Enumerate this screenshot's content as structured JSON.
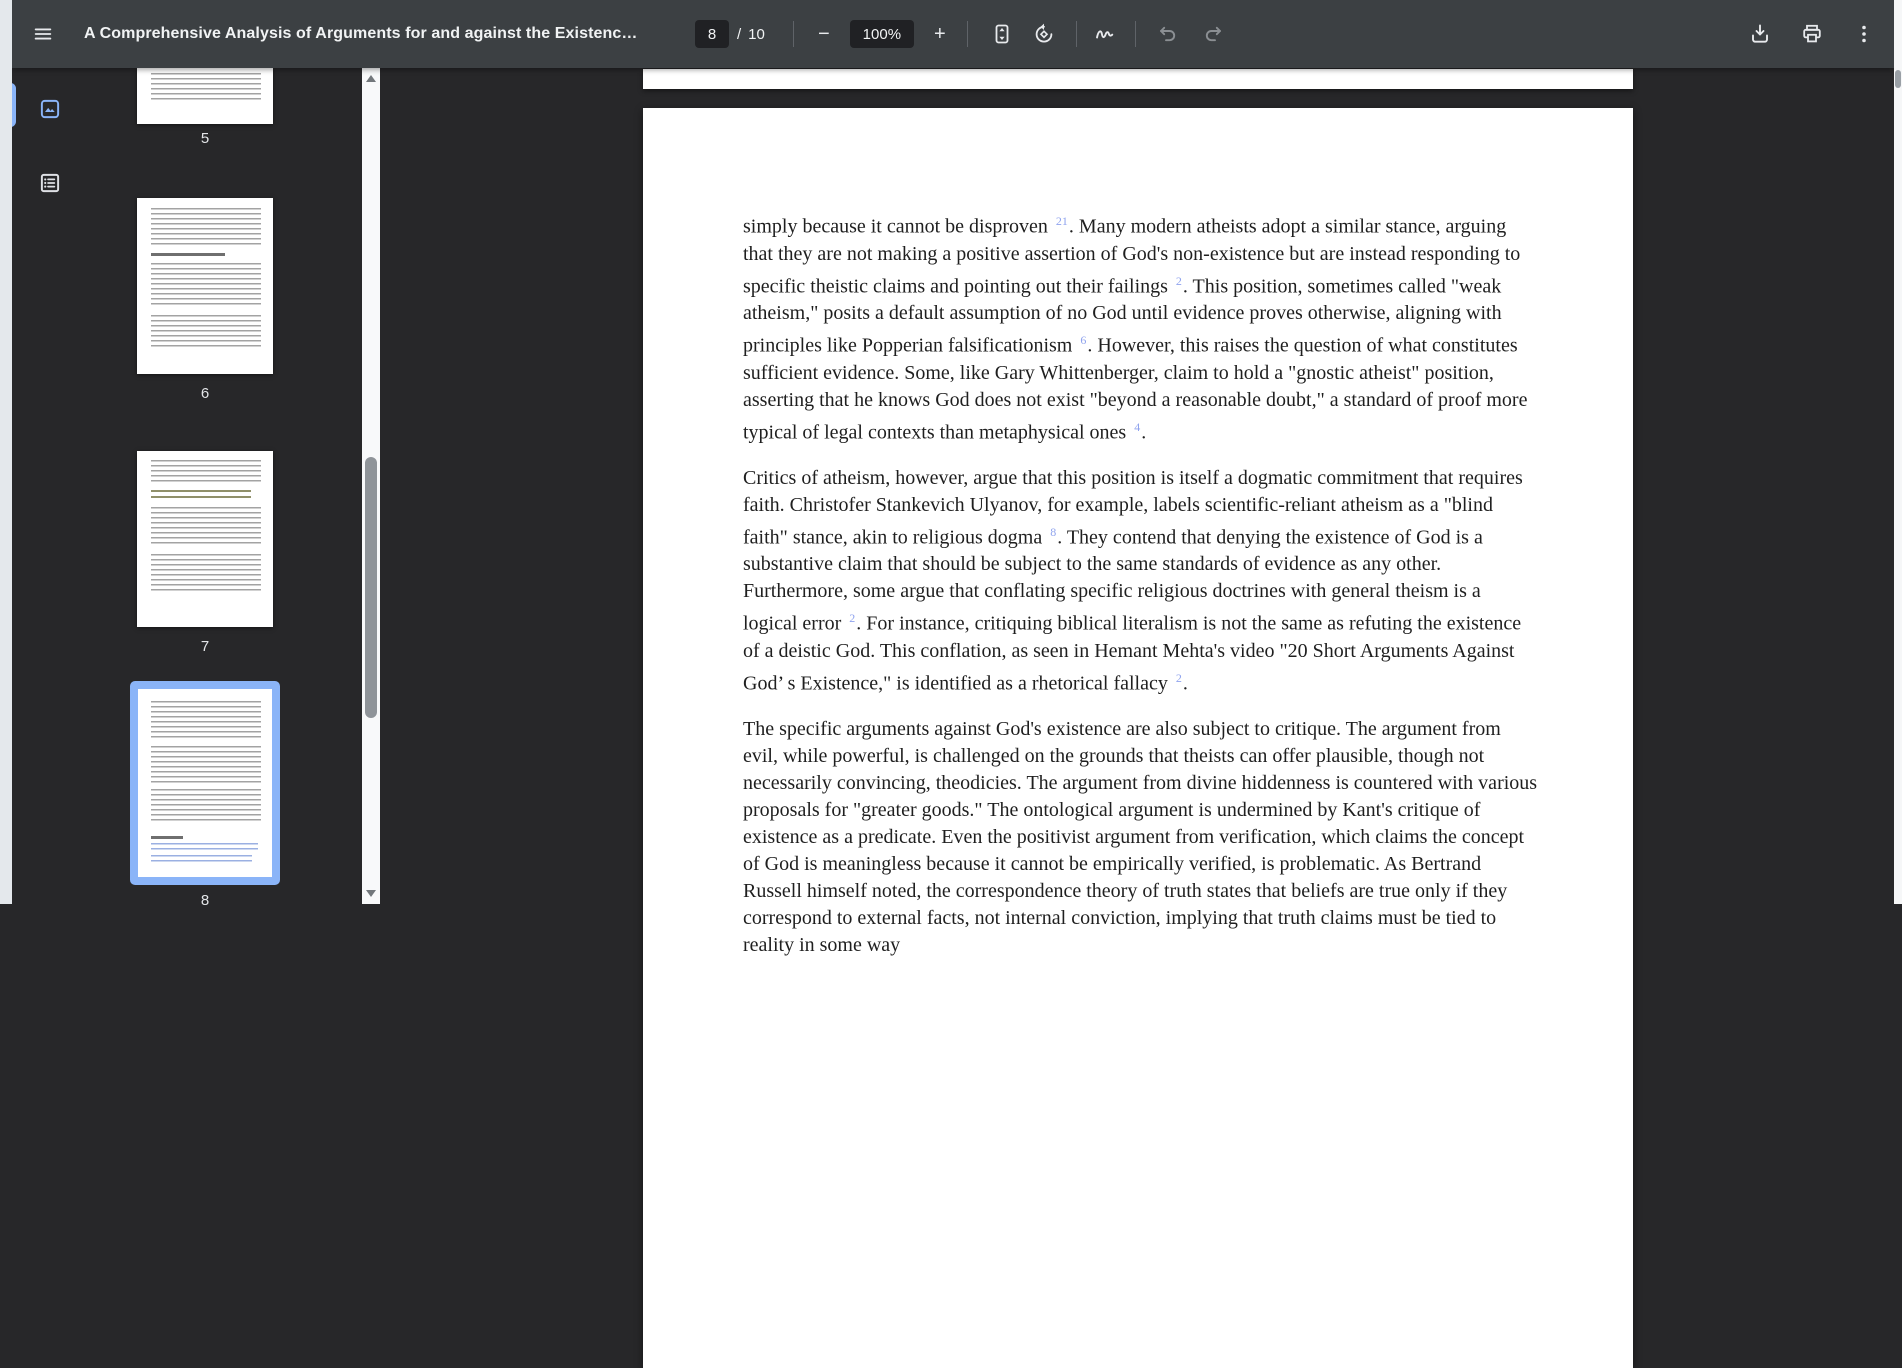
{
  "toolbar": {
    "title": "A Comprehensive Analysis of Arguments for and against the Existenc…",
    "page_input": "8",
    "page_divider": "/",
    "page_count": "10",
    "zoom_out_glyph": "−",
    "zoom_level": "100%",
    "zoom_in_glyph": "+",
    "icons": {
      "menu": "hamburger-menu",
      "fit": "fit-to-page",
      "rotate": "rotate-counterclockwise",
      "annotate": "pen-annotate",
      "undo": "undo-arrow",
      "redo": "redo-arrow",
      "download": "download-tray",
      "print": "printer",
      "more": "more-vertical-dots"
    }
  },
  "sidebar": {
    "views": [
      {
        "name": "thumbnails",
        "selected": true
      },
      {
        "name": "document-outline",
        "selected": false
      }
    ]
  },
  "thumbnails": {
    "pages": [
      {
        "label": "5",
        "selected": false
      },
      {
        "label": "6",
        "selected": false
      },
      {
        "label": "7",
        "selected": false
      },
      {
        "label": "8",
        "selected": true
      }
    ]
  },
  "document": {
    "paragraphs": [
      {
        "segments": [
          {
            "text": "simply because it cannot be disproven "
          },
          {
            "sup": "21"
          },
          {
            "text": ". Many modern atheists adopt a similar stance, arguing that they are not making a positive assertion of God's non-existence but are instead responding to specific theistic claims and pointing out their failings "
          },
          {
            "sup": "2"
          },
          {
            "text": ". This position, sometimes called \"weak atheism,\" posits a default assumption of no God until evidence proves otherwise, aligning with principles like Popperian falsificationism "
          },
          {
            "sup": "6"
          },
          {
            "text": ". However, this raises the question of what constitutes sufficient evidence. Some, like Gary Whittenberger, claim to hold a \"gnostic atheist\" position, asserting that he knows God does not exist \"beyond a reasonable doubt,\" a standard of proof more typical of legal contexts than metaphysical ones "
          },
          {
            "sup": "4"
          },
          {
            "text": "."
          }
        ]
      },
      {
        "segments": [
          {
            "text": "Critics of atheism, however, argue that this position is itself a dogmatic commitment that requires faith. Christofer Stankevich Ulyanov, for example, labels scientific-reliant atheism as a \"blind faith\" stance, akin to religious dogma "
          },
          {
            "sup": "8"
          },
          {
            "text": ". They contend that denying the existence of God is a substantive claim that should be subject to the same standards of evidence as any other. Furthermore, some argue that conflating specific religious doctrines with general theism is a logical error "
          },
          {
            "sup": "2"
          },
          {
            "text": ". For instance, critiquing biblical literalism is not the same as refuting the existence of a deistic God. This conflation, as seen in Hemant Mehta's video \"20 Short Arguments Against God’ s Existence,\" is identified as a rhetorical fallacy "
          },
          {
            "sup": "2"
          },
          {
            "text": "."
          }
        ]
      },
      {
        "segments": [
          {
            "text": "The specific arguments against God's existence are also subject to critique. The argument from evil, while powerful, is challenged on the grounds that theists can offer plausible, though not necessarily convincing, theodicies. The argument from divine hiddenness is countered with various proposals for \"greater goods.\" The ontological argument is undermined by Kant's critique of existence as a predicate. Even the positivist argument from verification, which claims the concept of God is meaningless because it cannot be empirically verified, is problematic. As Bertrand Russell himself noted, the correspondence theory of truth states that beliefs are true only if they correspond to external facts, not internal conviction, implying that truth claims must be tied to reality in some way"
          }
        ]
      }
    ]
  },
  "colors": {
    "accent_blue": "#8ab4f8",
    "toolbar_bg": "#3c4043",
    "viewer_bg": "#272729",
    "input_bg": "#202124",
    "citation_link": "#8fa3ee"
  }
}
